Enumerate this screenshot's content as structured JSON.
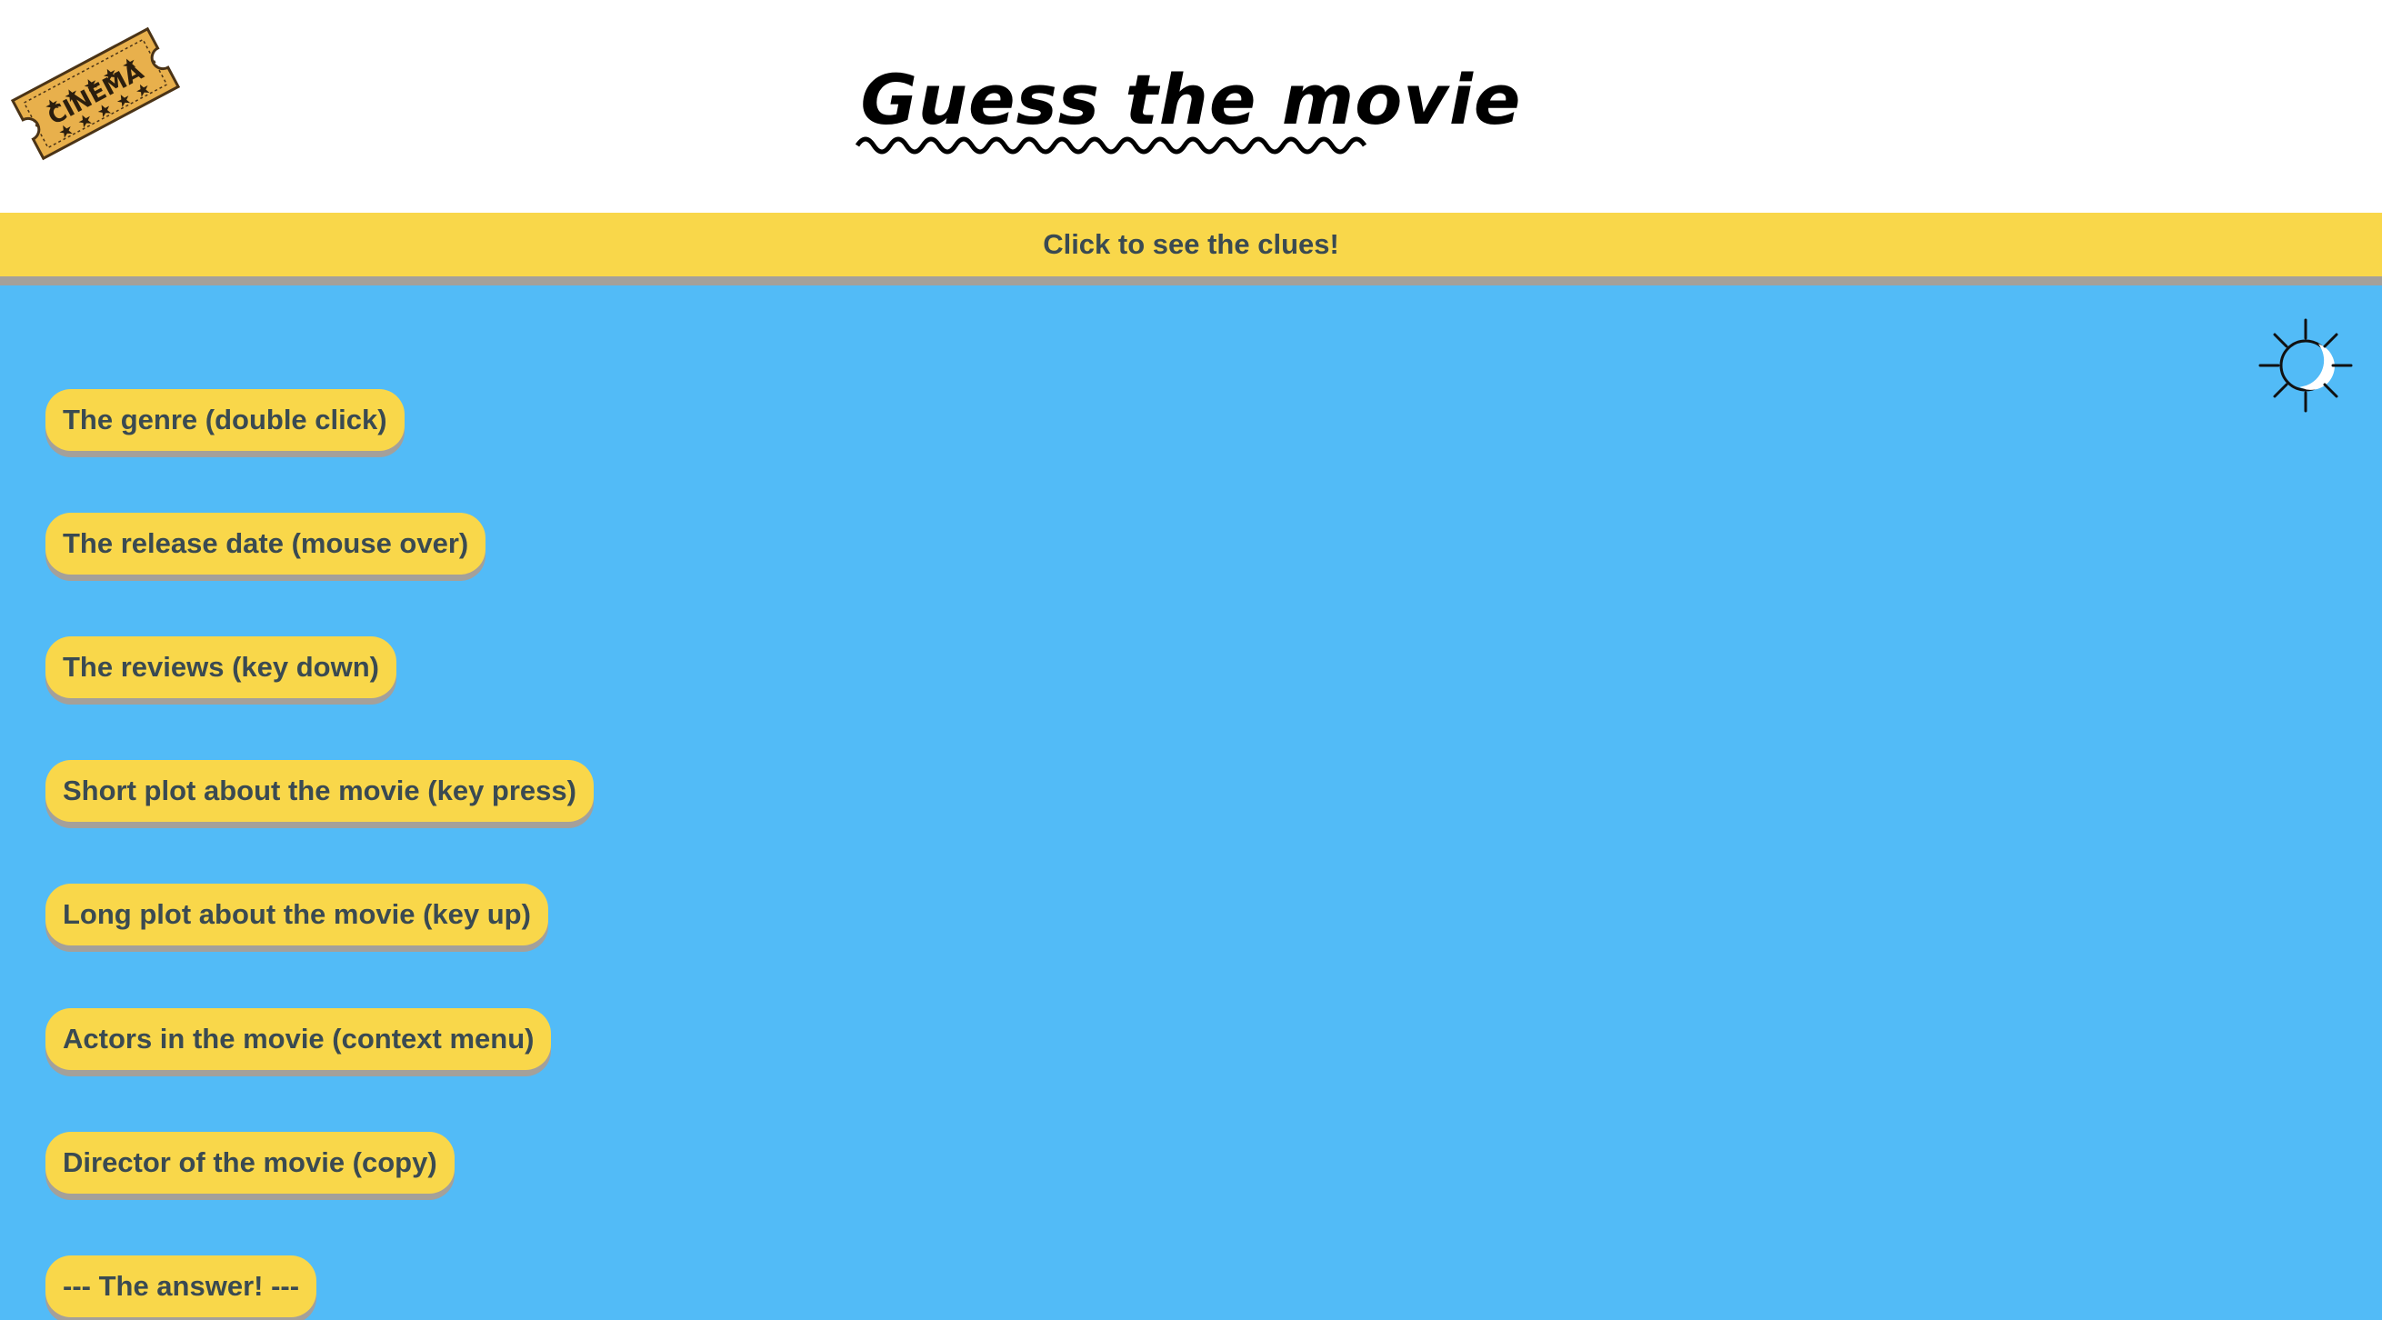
{
  "logo": {
    "text": "CINEMA",
    "icon": "cinema-ticket-icon"
  },
  "header": {
    "title": "Guess the movie"
  },
  "banner": {
    "label": "Click to see the clues!"
  },
  "theme_toggle": {
    "icon": "sun-moon-icon"
  },
  "clues": [
    {
      "label": "The genre (double click)"
    },
    {
      "label": "The release date (mouse over)"
    },
    {
      "label": "The reviews (key down)"
    },
    {
      "label": "Short plot about the movie (key press)"
    },
    {
      "label": "Long plot about the movie (key up)"
    },
    {
      "label": "Actors in the movie (context menu)"
    },
    {
      "label": "Director of the movie (copy)"
    },
    {
      "label": "--- The answer! ---"
    }
  ],
  "colors": {
    "background": "#52bbf7",
    "accent": "#f9d74a",
    "button_shadow": "#a4a09a",
    "button_text": "#3a4a52"
  }
}
